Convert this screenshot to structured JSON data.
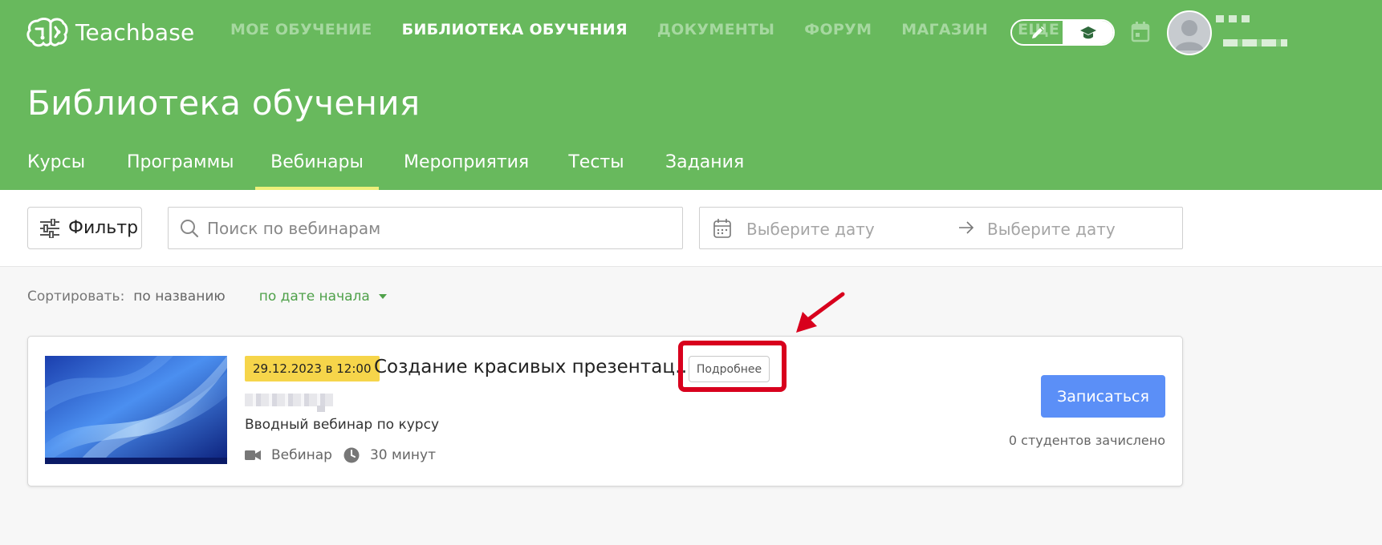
{
  "brand": {
    "name": "Teachbase"
  },
  "topnav": {
    "items": [
      {
        "label": "МОЕ ОБУЧЕНИЕ",
        "active": false
      },
      {
        "label": "БИБЛИОТЕКА ОБУЧЕНИЯ",
        "active": true
      },
      {
        "label": "ДОКУМЕНТЫ",
        "active": false
      },
      {
        "label": "ФОРУМ",
        "active": false
      },
      {
        "label": "МАГАЗИН",
        "active": false
      },
      {
        "label": "ЕЩЕ",
        "active": false
      }
    ]
  },
  "header": {
    "title": "Библиотека обучения"
  },
  "subtabs": [
    {
      "label": "Курсы"
    },
    {
      "label": "Программы"
    },
    {
      "label": "Вебинары",
      "active": true
    },
    {
      "label": "Мероприятия"
    },
    {
      "label": "Тесты"
    },
    {
      "label": "Задания"
    }
  ],
  "toolbar": {
    "filter_label": "Фильтр",
    "search_placeholder": "Поиск по вебинарам",
    "date_from_placeholder": "Выберите дату",
    "date_to_placeholder": "Выберите дату"
  },
  "sort": {
    "label": "Сортировать:",
    "option_name": "по названию",
    "option_date": "по дате начала"
  },
  "webinar": {
    "date": "29.12.2023 в 12:00",
    "title": "Создание красивых презентац…",
    "more_label": "Подробнее",
    "description": "Вводный вебинар по курсу",
    "type": "Вебинар",
    "duration": "30 минут",
    "enroll_label": "Записаться",
    "students": "0 студентов зачислено"
  },
  "colors": {
    "header_green": "#68b95d",
    "accent_yellow": "#f6d54a",
    "primary_blue": "#5b8ff7",
    "highlight_red": "#d8001d"
  }
}
